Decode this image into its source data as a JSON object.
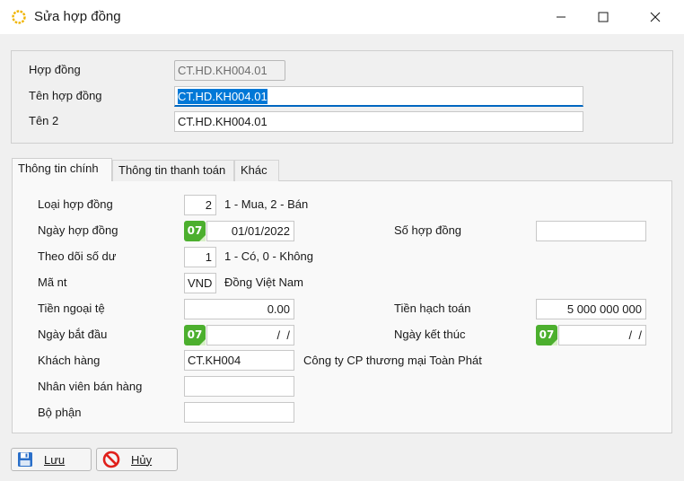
{
  "window": {
    "title": "Sửa hợp đồng"
  },
  "header": {
    "contract_label": "Hợp đồng",
    "contract_value": "CT.HD.KH004.01",
    "name_label": "Tên hợp đồng",
    "name_value": "CT.HD.KH004.01",
    "name2_label": "Tên 2",
    "name2_value": "CT.HD.KH004.01"
  },
  "tabs": [
    {
      "label": "Thông tin chính",
      "active": true
    },
    {
      "label": "Thông tin thanh toán",
      "active": false
    },
    {
      "label": "Khác",
      "active": false
    }
  ],
  "form": {
    "contract_type": {
      "label": "Loại hợp đồng",
      "value": "2",
      "hint": "1 - Mua, 2 - Bán"
    },
    "contract_date": {
      "label": "Ngày hợp đồng",
      "badge": "07",
      "value": "01/01/2022"
    },
    "contract_no": {
      "label": "Số hợp đồng",
      "value": ""
    },
    "track_balance": {
      "label": "Theo dõi số dư",
      "value": "1",
      "hint": "1 - Có, 0 - Không"
    },
    "currency": {
      "label": "Mã nt",
      "value": "VND",
      "name": "Đồng Việt Nam"
    },
    "foreign_amount": {
      "label": "Tiền ngoại tệ",
      "value": "0.00"
    },
    "accounting_amount": {
      "label": "Tiền hạch toán",
      "value": "5 000 000 000"
    },
    "start_date": {
      "label": "Ngày bắt đầu",
      "badge": "07",
      "value": "  /  /"
    },
    "end_date": {
      "label": "Ngày kết thúc",
      "badge": "07",
      "value": "  /  /"
    },
    "customer": {
      "label": "Khách hàng",
      "value": "CT.KH004",
      "name": "Công ty CP thương mại Toàn Phát"
    },
    "salesperson": {
      "label": "Nhân viên bán hàng",
      "value": ""
    },
    "department": {
      "label": "Bộ phận",
      "value": ""
    }
  },
  "buttons": {
    "save": "Lưu",
    "cancel": "Hủy"
  },
  "colors": {
    "accent": "#0067c0",
    "date_badge": "#4caf2e",
    "cancel_icon": "#e0201b",
    "save_icon": "#2a6fc9"
  }
}
